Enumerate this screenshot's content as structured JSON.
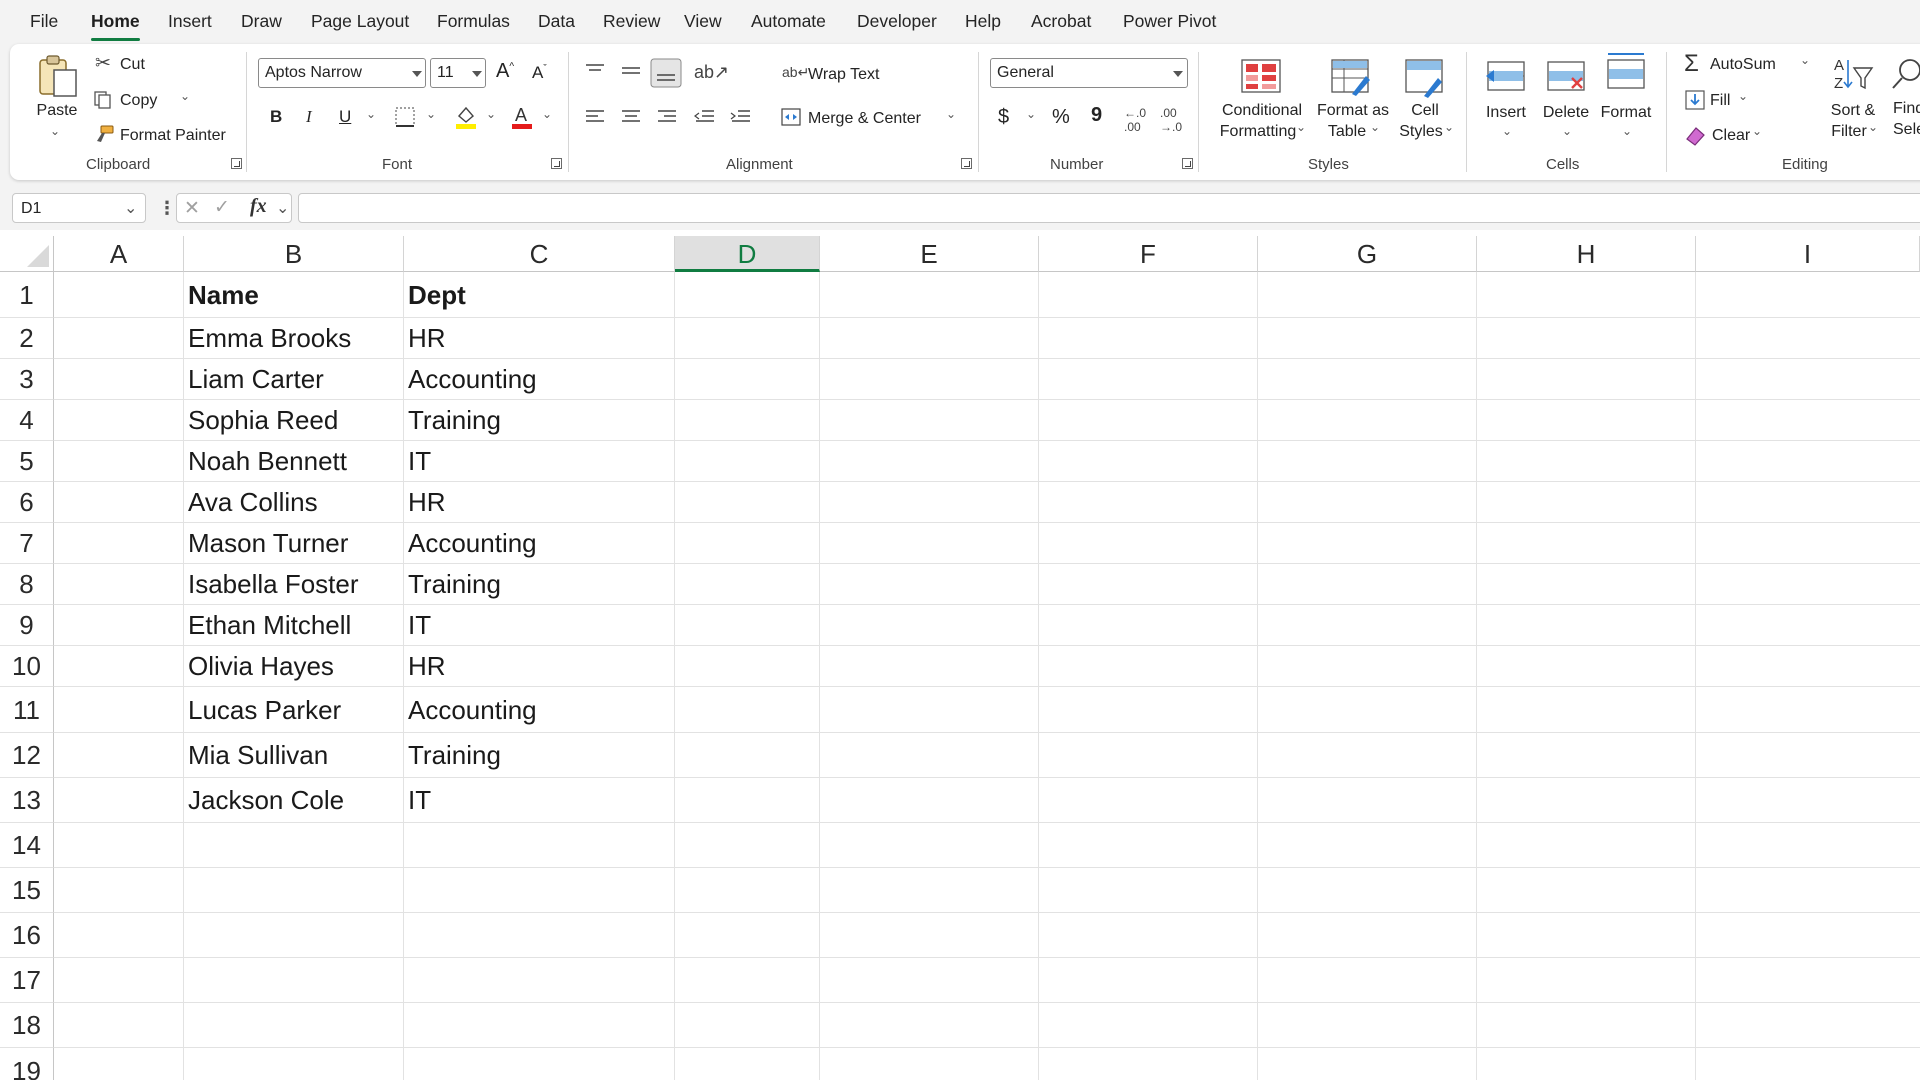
{
  "menu": {
    "tabs": [
      "File",
      "Home",
      "Insert",
      "Draw",
      "Page Layout",
      "Formulas",
      "Data",
      "Review",
      "View",
      "Automate",
      "Developer",
      "Help",
      "Acrobat",
      "Power Pivot"
    ],
    "active": "Home"
  },
  "ribbon": {
    "clipboard": {
      "paste": "Paste",
      "cut": "Cut",
      "copy": "Copy",
      "format_painter": "Format Painter",
      "label": "Clipboard"
    },
    "font": {
      "font_name": "Aptos Narrow",
      "font_size": "11",
      "bold": "B",
      "italic": "I",
      "underline": "U",
      "label": "Font"
    },
    "alignment": {
      "wrap_text": "Wrap Text",
      "merge_center": "Merge & Center",
      "label": "Alignment"
    },
    "number": {
      "format": "General",
      "currency": "$",
      "percent": "%",
      "comma": "9",
      "label": "Number"
    },
    "styles": {
      "conditional_1": "Conditional",
      "conditional_2": "Formatting",
      "format_table_1": "Format as",
      "format_table_2": "Table",
      "cell_styles_1": "Cell",
      "cell_styles_2": "Styles",
      "label": "Styles"
    },
    "cells": {
      "insert": "Insert",
      "delete": "Delete",
      "format": "Format",
      "label": "Cells"
    },
    "editing": {
      "autosum": "AutoSum",
      "fill": "Fill",
      "clear": "Clear",
      "sort_1": "Sort &",
      "sort_2": "Filter",
      "find_1": "Find",
      "find_2": "Select",
      "label": "Editing"
    }
  },
  "formula_bar": {
    "name_box": "D1",
    "fx": "fx",
    "formula": ""
  },
  "sheet": {
    "columns": [
      "A",
      "B",
      "C",
      "D",
      "E",
      "F",
      "G",
      "H",
      "I"
    ],
    "selected_column": "D",
    "rows": [
      "1",
      "2",
      "3",
      "4",
      "5",
      "6",
      "7",
      "8",
      "9",
      "10",
      "11",
      "12",
      "13",
      "14",
      "15",
      "16",
      "17",
      "18",
      "19"
    ],
    "header": {
      "name": "Name",
      "dept": "Dept"
    },
    "data": [
      {
        "name": "Emma Brooks",
        "dept": "HR"
      },
      {
        "name": "Liam Carter",
        "dept": "Accounting"
      },
      {
        "name": "Sophia Reed",
        "dept": "Training"
      },
      {
        "name": "Noah Bennett",
        "dept": "IT"
      },
      {
        "name": "Ava Collins",
        "dept": "HR"
      },
      {
        "name": "Mason Turner",
        "dept": "Accounting"
      },
      {
        "name": "Isabella Foster",
        "dept": "Training"
      },
      {
        "name": "Ethan Mitchell",
        "dept": "IT"
      },
      {
        "name": "Olivia Hayes",
        "dept": "HR"
      },
      {
        "name": "Lucas Parker",
        "dept": "Accounting"
      },
      {
        "name": "Mia Sullivan",
        "dept": "Training"
      },
      {
        "name": "Jackson Cole",
        "dept": "IT"
      }
    ]
  }
}
